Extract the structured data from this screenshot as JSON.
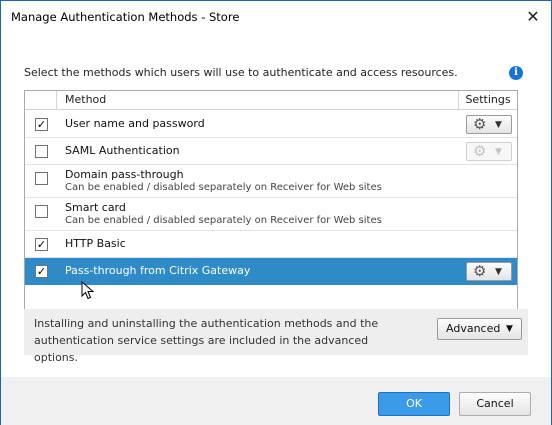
{
  "window": {
    "title": "Manage Authentication Methods - Store",
    "close_glyph": "✕"
  },
  "intro_text": "Select the methods which users will use to authenticate and access resources.",
  "info_icon": {
    "name": "info-icon",
    "glyph": "i",
    "color": "#1874cf"
  },
  "table": {
    "headers": {
      "method": "Method",
      "settings": "Settings"
    },
    "rows": [
      {
        "label": "User name and password",
        "sublabel": "",
        "checked": true,
        "settings": "enabled"
      },
      {
        "label": "SAML Authentication",
        "sublabel": "",
        "checked": false,
        "settings": "disabled"
      },
      {
        "label": "Domain pass-through",
        "sublabel": "Can be enabled / disabled separately on Receiver for Web sites",
        "checked": false,
        "settings": "none"
      },
      {
        "label": "Smart card",
        "sublabel": "Can be enabled / disabled separately on Receiver for Web sites",
        "checked": false,
        "settings": "none"
      },
      {
        "label": "HTTP Basic",
        "sublabel": "",
        "checked": true,
        "settings": "none"
      },
      {
        "label": "Pass-through from Citrix Gateway",
        "sublabel": "",
        "checked": true,
        "settings": "enabled",
        "selected": true
      }
    ],
    "settings_button": {
      "gear_glyph": "⚙",
      "caret_glyph": "▼"
    },
    "check_glyph": "✓"
  },
  "advanced_panel": {
    "text": "Installing and uninstalling the authentication methods and the authentication service settings are included in the advanced options.",
    "button_label": "Advanced",
    "caret_glyph": "▼"
  },
  "footer": {
    "ok_label": "OK",
    "cancel_label": "Cancel"
  },
  "colors": {
    "selection": "#2e8bc7",
    "primary_button": "#3c9be8",
    "window_border": "#1e64b4"
  }
}
